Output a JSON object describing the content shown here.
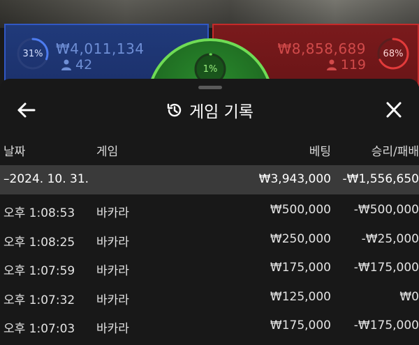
{
  "scoreboard": {
    "blue": {
      "percent": "31%",
      "percent_value": 0.31,
      "amount": "₩4,011,134",
      "players": "42",
      "color": "#3158c4"
    },
    "red": {
      "percent": "68%",
      "percent_value": 0.68,
      "amount": "₩8,858,689",
      "players": "119",
      "color": "#c52a2a"
    },
    "tie": {
      "percent": "1%",
      "percent_value": 0.01,
      "color": "#6fdc55"
    }
  },
  "sheet": {
    "title": "게임 기록",
    "title_icon": "history-icon",
    "back_icon": "arrow-left-icon",
    "close_icon": "close-icon"
  },
  "table": {
    "headers": {
      "date": "날짜",
      "game": "게임",
      "bet": "베팅",
      "result": "승리/패배"
    },
    "date_group": {
      "label": "–2024. 10. 31.",
      "bet_total": "₩3,943,000",
      "result_total": "-₩1,556,650"
    },
    "rows": [
      {
        "time": "오후 1:08:53",
        "game": "바카라",
        "bet": "₩500,000",
        "result": "-₩500,000"
      },
      {
        "time": "오후 1:08:25",
        "game": "바카라",
        "bet": "₩250,000",
        "result": "-₩25,000"
      },
      {
        "time": "오후 1:07:59",
        "game": "바카라",
        "bet": "₩175,000",
        "result": "-₩175,000"
      },
      {
        "time": "오후 1:07:32",
        "game": "바카라",
        "bet": "₩125,000",
        "result": "₩0"
      },
      {
        "time": "오후 1:07:03",
        "game": "바카라",
        "bet": "₩175,000",
        "result": "-₩175,000"
      }
    ]
  }
}
